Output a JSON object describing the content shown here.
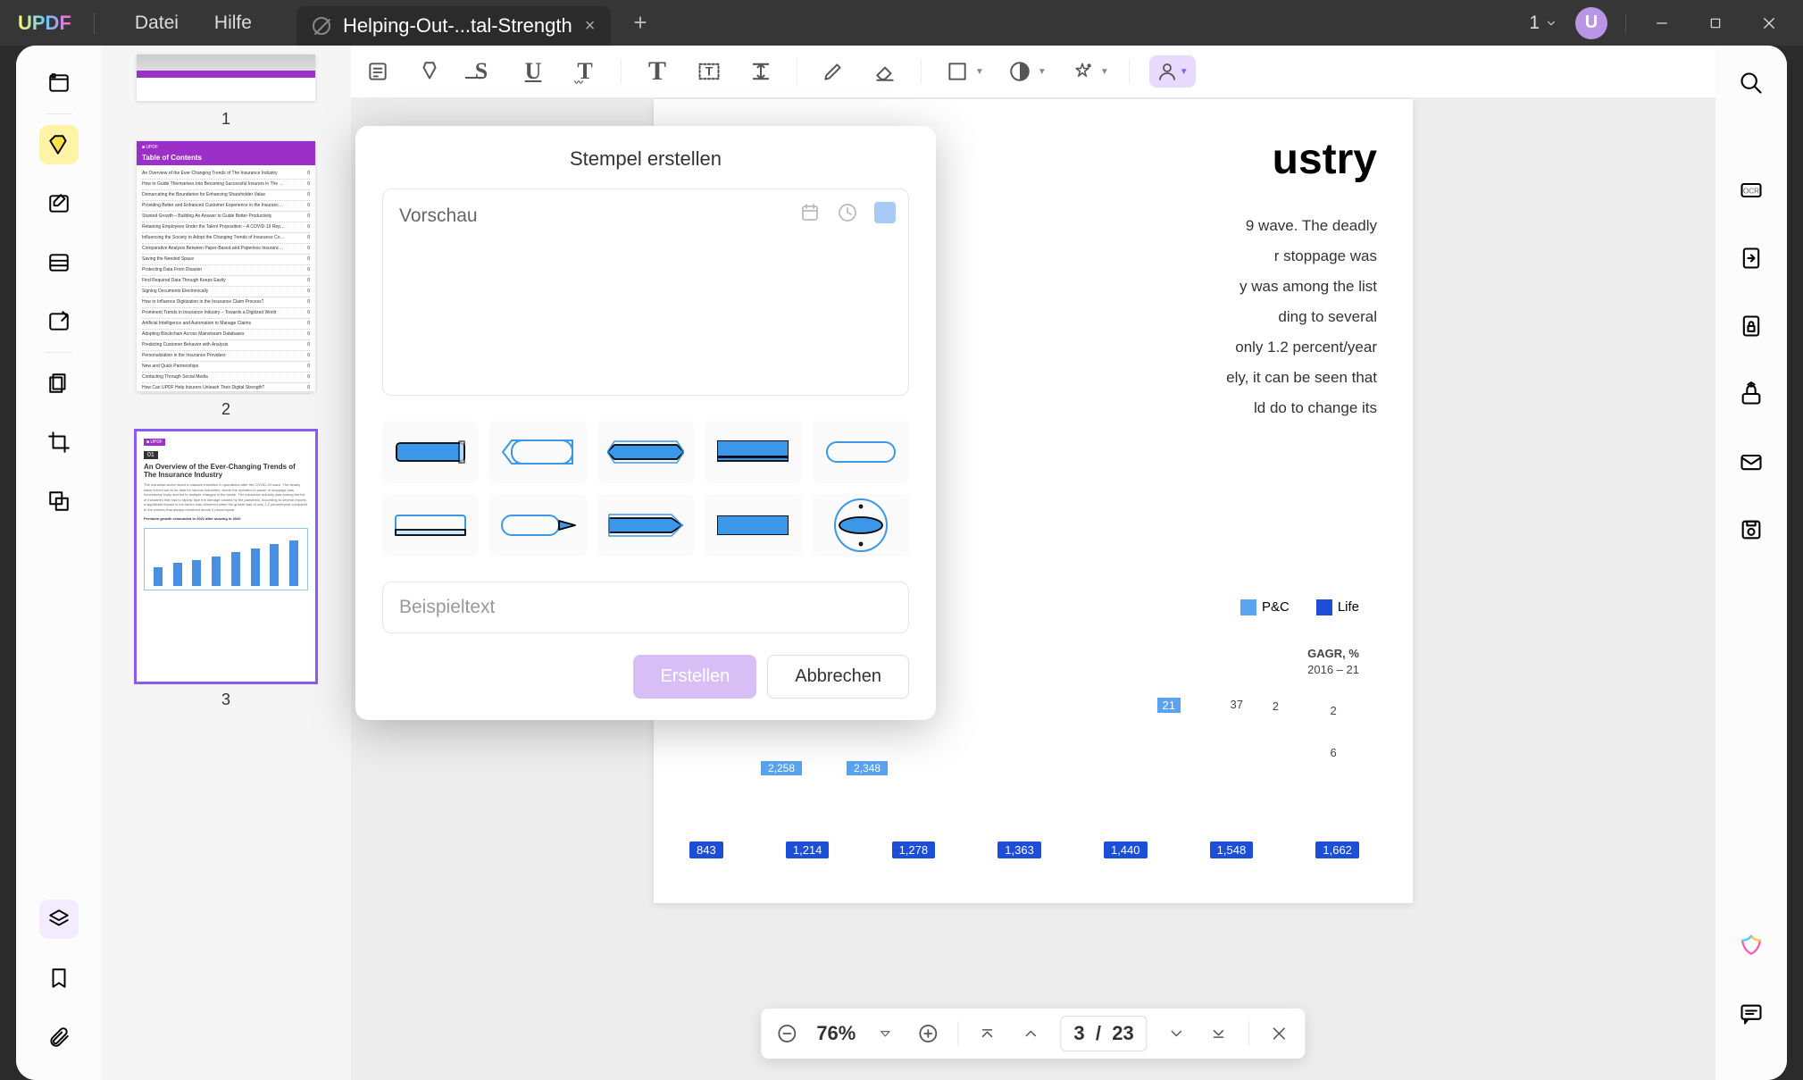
{
  "titlebar": {
    "logo": "UPDF",
    "menu": {
      "file": "Datei",
      "help": "Hilfe"
    },
    "tab": {
      "title": "Helping-Out-...tal-Strength",
      "close": "×"
    },
    "add_tab": "+",
    "page_indicator": "1",
    "avatar": "U"
  },
  "toolbar": {
    "items": [
      "note",
      "highlight",
      "strike",
      "underline",
      "T",
      "T-large",
      "textbox",
      "line-spacing",
      "pencil",
      "eraser",
      "shape",
      "stamp",
      "pin",
      "user"
    ]
  },
  "dialog": {
    "title": "Stempel erstellen",
    "preview_label": "Vorschau",
    "preview_color": "#a8cbf5",
    "text_placeholder": "Beispieltext",
    "create": "Erstellen",
    "cancel": "Abbrechen"
  },
  "pagination": {
    "zoom": "76%",
    "page": "3",
    "sep": "/",
    "total": "23"
  },
  "thumbnails": {
    "p1": "1",
    "p2": "2",
    "p3": "3",
    "t2_header": "Table of Contents",
    "t2_rows": [
      "An Overview of the Ever-Changing Trends of The Insurance Industry",
      "How to Guide Themselves Into Becoming Successful Insurers in The Current Environment?",
      "Demarcating the Boundaries for Enhancing Shareholder Value",
      "Providing Better and Enhanced Customer Experience in the Insurance Sector",
      "Stunted Growth – Building An Answer to Guide Better Productivity",
      "Retaining Employees Under the Talent Proposition – A COVID-19 Repercussion",
      "Influencing the Society to Adopt the Changing Trends of Insurance Companies",
      "Comparative Analysis Between Paper-Based and Paperless Insurance Companies",
      "Saving the Needed Space",
      "Protecting Data From Disaster",
      "Find Required Data Through Keeps Easily",
      "Signing Documents Electronically",
      "How to Influence Digitization in the Insurance Claim Process?",
      "Prominent Trends in Insurance Industry – Towards a Digitized World",
      "Artificial Intelligence and Automation to Manage Claims",
      "Adopting Blockchain Across Mainstream Databases",
      "Predicting Customer Behavior with Analysis",
      "Personalization in the Insurance Providers",
      "New and Quick Partnerships",
      "Contacting Through Social Media",
      "How Can UPDF Help Insurers Unleash Their Digital Strength?"
    ],
    "t3_badge": "01",
    "t3_title": "An Overview of the Ever-Changing Trends of The Insurance Industry"
  },
  "document": {
    "title_frag": "ustry",
    "lines": [
      "9 wave. The deadly",
      "r stoppage was",
      "y was among the list",
      "ding to several",
      "only 1.2 percent/year",
      "ely, it can be seen that",
      "ld do to change its"
    ],
    "legend": {
      "pc": "P&C",
      "life": "Life",
      "pc_color": "#5aa3f0",
      "life_color": "#1d4ed8"
    },
    "cagr_label": "GAGR, %",
    "cagr_range": "2016 – 21",
    "top_vals": [
      "2,258",
      "2,348"
    ],
    "extra_top": [
      "37",
      "21"
    ],
    "extra_r1": "2",
    "extra_r2": "2",
    "extra_r3": "6",
    "bottom_vals": [
      "843",
      "1,214",
      "1,278",
      "1,363",
      "1,440",
      "1,548",
      "1,662"
    ]
  }
}
